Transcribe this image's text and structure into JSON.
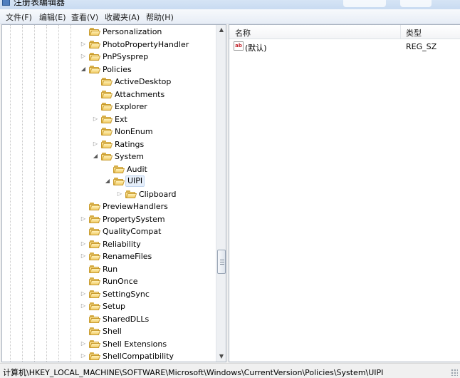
{
  "window": {
    "title": "注册表编辑器"
  },
  "menu": [
    "文件(F)",
    "编辑(E)",
    "查看(V)",
    "收藏夹(A)",
    "帮助(H)"
  ],
  "tree": [
    {
      "label": "Personalization",
      "depth": 0,
      "expander": "none"
    },
    {
      "label": "PhotoPropertyHandler",
      "depth": 0,
      "expander": "collapsed"
    },
    {
      "label": "PnPSysprep",
      "depth": 0,
      "expander": "collapsed"
    },
    {
      "label": "Policies",
      "depth": 0,
      "expander": "expanded"
    },
    {
      "label": "ActiveDesktop",
      "depth": 1,
      "expander": "none"
    },
    {
      "label": "Attachments",
      "depth": 1,
      "expander": "none"
    },
    {
      "label": "Explorer",
      "depth": 1,
      "expander": "none"
    },
    {
      "label": "Ext",
      "depth": 1,
      "expander": "collapsed"
    },
    {
      "label": "NonEnum",
      "depth": 1,
      "expander": "none"
    },
    {
      "label": "Ratings",
      "depth": 1,
      "expander": "collapsed"
    },
    {
      "label": "System",
      "depth": 1,
      "expander": "expanded"
    },
    {
      "label": "Audit",
      "depth": 2,
      "expander": "none"
    },
    {
      "label": "UIPI",
      "depth": 2,
      "expander": "expanded",
      "selected": true
    },
    {
      "label": "Clipboard",
      "depth": 3,
      "expander": "collapsed"
    },
    {
      "label": "PreviewHandlers",
      "depth": 0,
      "expander": "none"
    },
    {
      "label": "PropertySystem",
      "depth": 0,
      "expander": "collapsed"
    },
    {
      "label": "QualityCompat",
      "depth": 0,
      "expander": "none"
    },
    {
      "label": "Reliability",
      "depth": 0,
      "expander": "collapsed"
    },
    {
      "label": "RenameFiles",
      "depth": 0,
      "expander": "collapsed"
    },
    {
      "label": "Run",
      "depth": 0,
      "expander": "none"
    },
    {
      "label": "RunOnce",
      "depth": 0,
      "expander": "none"
    },
    {
      "label": "SettingSync",
      "depth": 0,
      "expander": "collapsed"
    },
    {
      "label": "Setup",
      "depth": 0,
      "expander": "collapsed"
    },
    {
      "label": "SharedDLLs",
      "depth": 0,
      "expander": "none"
    },
    {
      "label": "Shell",
      "depth": 0,
      "expander": "none"
    },
    {
      "label": "Shell Extensions",
      "depth": 0,
      "expander": "collapsed"
    },
    {
      "label": "ShellCompatibility",
      "depth": 0,
      "expander": "collapsed"
    }
  ],
  "values": {
    "columns": {
      "name": "名称",
      "type": "类型"
    },
    "rows": [
      {
        "icon": "string-value-icon",
        "icon_text": "ab",
        "name": "(默认)",
        "type": "REG_SZ"
      }
    ]
  },
  "status": {
    "path": "计算机\\HKEY_LOCAL_MACHINE\\SOFTWARE\\Microsoft\\Windows\\CurrentVersion\\Policies\\System\\UIPI"
  }
}
